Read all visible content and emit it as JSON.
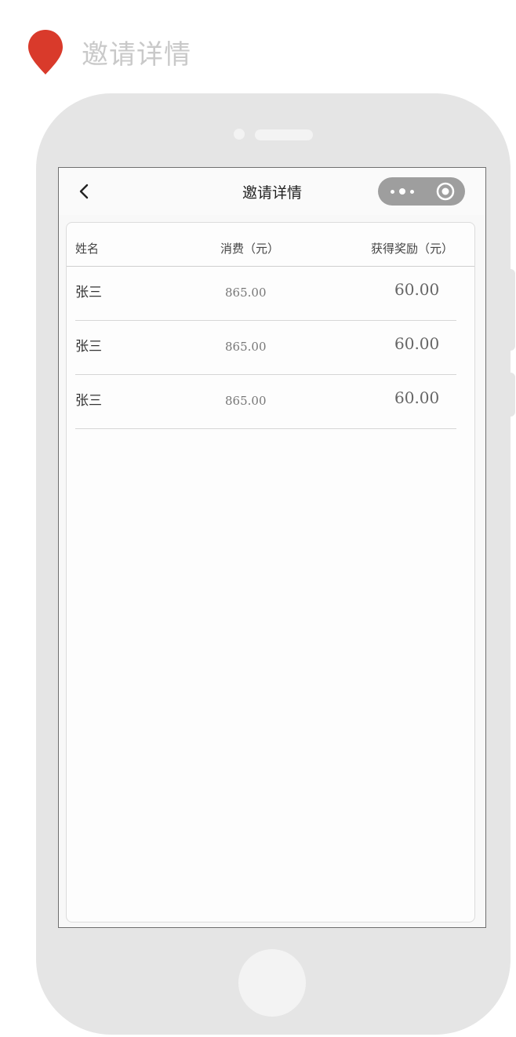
{
  "page_label": {
    "text": "邀请详情",
    "pin_color": "#d93a2b"
  },
  "nav": {
    "back_icon": "chevron-left-icon",
    "title": "邀请详情",
    "capsule": {
      "menu_icon": "more-dots-icon",
      "close_icon": "target-circle-icon"
    }
  },
  "table": {
    "headers": {
      "name": "姓名",
      "spend": "消费（元）",
      "reward": "获得奖励（元）"
    },
    "rows": [
      {
        "name": "张三",
        "spend": "865.00",
        "reward": "60.00"
      },
      {
        "name": "张三",
        "spend": "865.00",
        "reward": "60.00"
      },
      {
        "name": "张三",
        "spend": "865.00",
        "reward": "60.00"
      }
    ]
  }
}
